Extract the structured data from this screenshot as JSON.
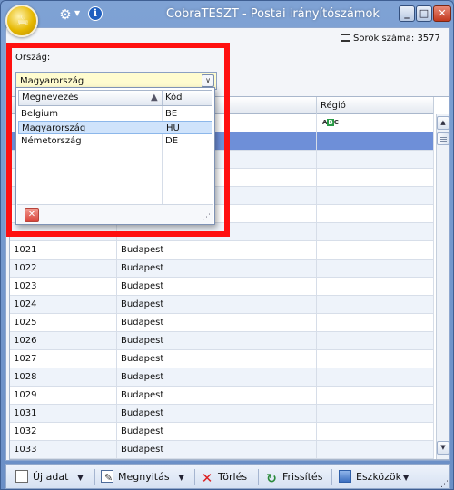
{
  "window": {
    "title": "CobraTESZT - Postai irányítószámok",
    "minimize_glyph": "_",
    "maximize_glyph": "□",
    "close_glyph": "✕"
  },
  "header": {
    "rows_count_text": "Sorok száma: 3577",
    "country_label": "Ország:",
    "country_value": "Magyarország"
  },
  "grid": {
    "columns": [
      "",
      "",
      "Régió"
    ],
    "filter_abc": "ABC",
    "rows": [
      {
        "code": "",
        "city": "",
        "region": "",
        "state": "sel"
      },
      {
        "code": "",
        "city": "",
        "region": "",
        "state": "alt"
      },
      {
        "code": "",
        "city": "",
        "region": "",
        "state": ""
      },
      {
        "code": "",
        "city": "",
        "region": "",
        "state": "alt"
      },
      {
        "code": "",
        "city": "",
        "region": "",
        "state": ""
      },
      {
        "code": "",
        "city": "",
        "region": "",
        "state": "alt"
      },
      {
        "code": "1021",
        "city": "Budapest",
        "region": "",
        "state": ""
      },
      {
        "code": "1022",
        "city": "Budapest",
        "region": "",
        "state": "alt"
      },
      {
        "code": "1023",
        "city": "Budapest",
        "region": "",
        "state": ""
      },
      {
        "code": "1024",
        "city": "Budapest",
        "region": "",
        "state": "alt"
      },
      {
        "code": "1025",
        "city": "Budapest",
        "region": "",
        "state": ""
      },
      {
        "code": "1026",
        "city": "Budapest",
        "region": "",
        "state": "alt"
      },
      {
        "code": "1027",
        "city": "Budapest",
        "region": "",
        "state": ""
      },
      {
        "code": "1028",
        "city": "Budapest",
        "region": "",
        "state": "alt"
      },
      {
        "code": "1029",
        "city": "Budapest",
        "region": "",
        "state": ""
      },
      {
        "code": "1031",
        "city": "Budapest",
        "region": "",
        "state": "alt"
      },
      {
        "code": "1032",
        "city": "Budapest",
        "region": "",
        "state": ""
      },
      {
        "code": "1033",
        "city": "Budapest",
        "region": "",
        "state": "alt"
      }
    ]
  },
  "dropdown": {
    "columns": [
      "Megnevezés",
      "Kód"
    ],
    "items": [
      {
        "name": "Belgium",
        "code": "BE",
        "selected": false
      },
      {
        "name": "Magyarország",
        "code": "HU",
        "selected": true
      },
      {
        "name": "Németország",
        "code": "DE",
        "selected": false
      }
    ]
  },
  "toolbar": {
    "new_label": "Új adat",
    "open_label": "Megnyitás",
    "delete_label": "Törlés",
    "refresh_label": "Frissítés",
    "tools_label": "Eszközök"
  },
  "colors": {
    "highlight": "#ff1010",
    "selected_row": "#6e8fd8",
    "combo_bg": "#fffccf"
  }
}
